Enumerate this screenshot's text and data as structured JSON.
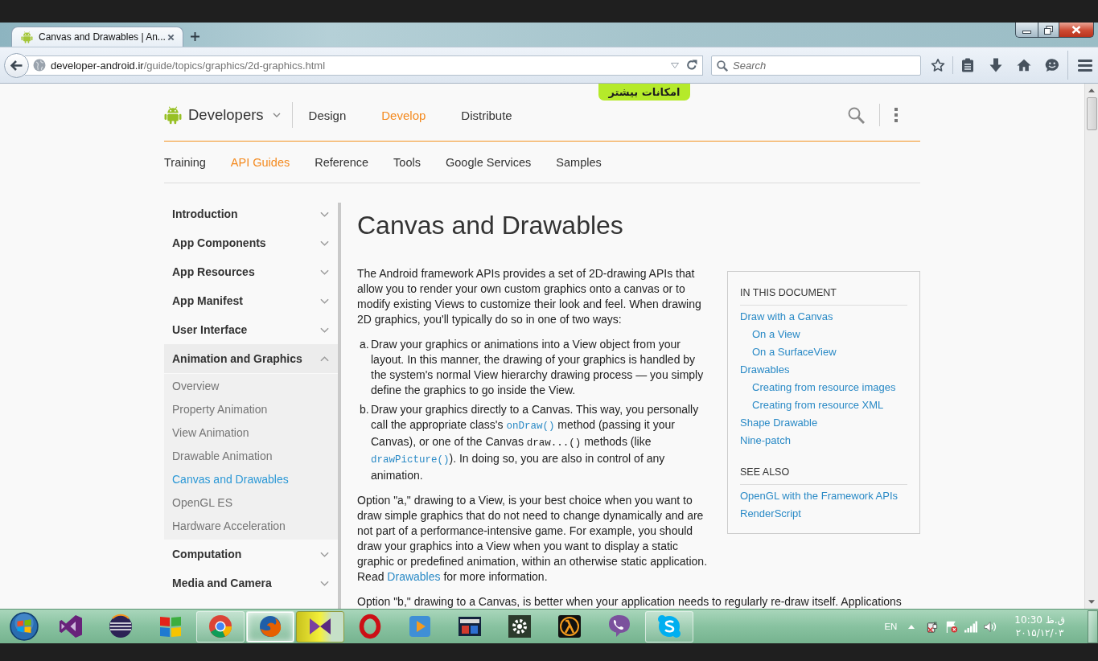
{
  "browser": {
    "tabs": [
      {
        "title": "Canvas and Drawables | An...",
        "selected": true
      }
    ],
    "address": {
      "host": "developer-android.ir",
      "path": "/guide/topics/graphics/2d-graphics.html"
    },
    "search": {
      "placeholder": "Search"
    }
  },
  "promo": {
    "label": "امکانات بیشتر"
  },
  "site": {
    "brand": "Developers",
    "sections": [
      {
        "label": "Design",
        "selected": false
      },
      {
        "label": "Develop",
        "selected": true
      },
      {
        "label": "Distribute",
        "selected": false
      }
    ],
    "subnav": [
      {
        "label": "Training",
        "selected": false
      },
      {
        "label": "API Guides",
        "selected": true
      },
      {
        "label": "Reference",
        "selected": false
      },
      {
        "label": "Tools",
        "selected": false
      },
      {
        "label": "Google Services",
        "selected": false
      },
      {
        "label": "Samples",
        "selected": false
      }
    ]
  },
  "sidebar": {
    "items": [
      {
        "label": "Introduction",
        "expanded": false
      },
      {
        "label": "App Components",
        "expanded": false
      },
      {
        "label": "App Resources",
        "expanded": false
      },
      {
        "label": "App Manifest",
        "expanded": false
      },
      {
        "label": "User Interface",
        "expanded": false
      },
      {
        "label": "Animation and Graphics",
        "expanded": true,
        "children": [
          {
            "label": "Overview",
            "selected": false
          },
          {
            "label": "Property Animation",
            "selected": false
          },
          {
            "label": "View Animation",
            "selected": false
          },
          {
            "label": "Drawable Animation",
            "selected": false
          },
          {
            "label": "Canvas and Drawables",
            "selected": true
          },
          {
            "label": "OpenGL ES",
            "selected": false
          },
          {
            "label": "Hardware Acceleration",
            "selected": false
          }
        ]
      },
      {
        "label": "Computation",
        "expanded": false
      },
      {
        "label": "Media and Camera",
        "expanded": false
      }
    ]
  },
  "article": {
    "title": "Canvas and Drawables",
    "blocks": [
      {
        "kind": "paragraph",
        "segments": [
          {
            "kind": "text",
            "text": "The Android framework APIs provides a set of 2D-drawing APIs that allow you to render your own custom graphics onto a canvas or to modify existing Views to customize their look and feel. When drawing 2D graphics, you'll typically do so in one of two ways:"
          }
        ]
      },
      {
        "kind": "list",
        "items": [
          {
            "marker": "a.",
            "segments": [
              {
                "kind": "text",
                "text": "Draw your graphics or animations into a View object from your layout. In this manner, the drawing of your graphics is handled by the system's normal View hierarchy drawing process — you simply define the graphics to go inside the View."
              }
            ]
          },
          {
            "marker": "b.",
            "segments": [
              {
                "kind": "text",
                "text": "Draw your graphics directly to a Canvas. This way, you personally call the appropriate class's "
              },
              {
                "kind": "code-link",
                "text": "onDraw()"
              },
              {
                "kind": "text",
                "text": " method (passing it your Canvas), or one of the Canvas "
              },
              {
                "kind": "code",
                "text": "draw...()"
              },
              {
                "kind": "text",
                "text": " methods (like "
              },
              {
                "kind": "code-link",
                "text": "drawPicture()"
              },
              {
                "kind": "text",
                "text": "). In doing so, you are also in control of any animation."
              }
            ]
          }
        ]
      },
      {
        "kind": "paragraph",
        "segments": [
          {
            "kind": "text",
            "text": "Option \"a,\" drawing to a View, is your best choice when you want to draw simple graphics that do not need to change dynamically and are not part of a performance-intensive game. For example, you should draw your graphics into a View when you want to display a static graphic or predefined animation, within an otherwise static application. Read "
          },
          {
            "kind": "link",
            "text": "Drawables"
          },
          {
            "kind": "text",
            "text": " for more information."
          }
        ]
      },
      {
        "kind": "paragraph",
        "segments": [
          {
            "kind": "text",
            "text": "Option \"b,\" drawing to a Canvas, is better when your application needs to regularly re-draw itself. Applications"
          }
        ]
      }
    ]
  },
  "toc": {
    "sections": [
      {
        "heading": "IN THIS DOCUMENT",
        "links": [
          {
            "label": "Draw with a Canvas",
            "children": [
              {
                "label": "On a View"
              },
              {
                "label": "On a SurfaceView"
              }
            ]
          },
          {
            "label": "Drawables",
            "children": [
              {
                "label": "Creating from resource images"
              },
              {
                "label": "Creating from resource XML"
              }
            ]
          },
          {
            "label": "Shape Drawable"
          },
          {
            "label": "Nine-patch"
          }
        ]
      },
      {
        "heading": "SEE ALSO",
        "links": [
          {
            "label": "OpenGL with the Framework APIs"
          },
          {
            "label": "RenderScript"
          }
        ]
      }
    ]
  },
  "taskbar": {
    "apps": [
      {
        "running": false,
        "selected": false,
        "highlighted": false
      },
      {
        "running": false,
        "selected": false,
        "highlighted": false
      },
      {
        "running": false,
        "selected": false,
        "highlighted": false
      },
      {
        "running": true,
        "selected": false,
        "highlighted": false
      },
      {
        "running": true,
        "selected": true,
        "highlighted": false
      },
      {
        "running": true,
        "selected": false,
        "highlighted": true
      },
      {
        "running": false,
        "selected": false,
        "highlighted": false
      },
      {
        "running": false,
        "selected": false,
        "highlighted": false
      },
      {
        "running": false,
        "selected": false,
        "highlighted": false
      },
      {
        "running": false,
        "selected": false,
        "highlighted": false
      },
      {
        "running": false,
        "selected": false,
        "highlighted": false
      },
      {
        "running": false,
        "selected": false,
        "highlighted": false
      },
      {
        "running": true,
        "selected": false,
        "highlighted": false
      }
    ],
    "language": "EN",
    "time": "ق.ظ 10:30",
    "date": "۲۰۱۵/۱۲/۰۳"
  }
}
